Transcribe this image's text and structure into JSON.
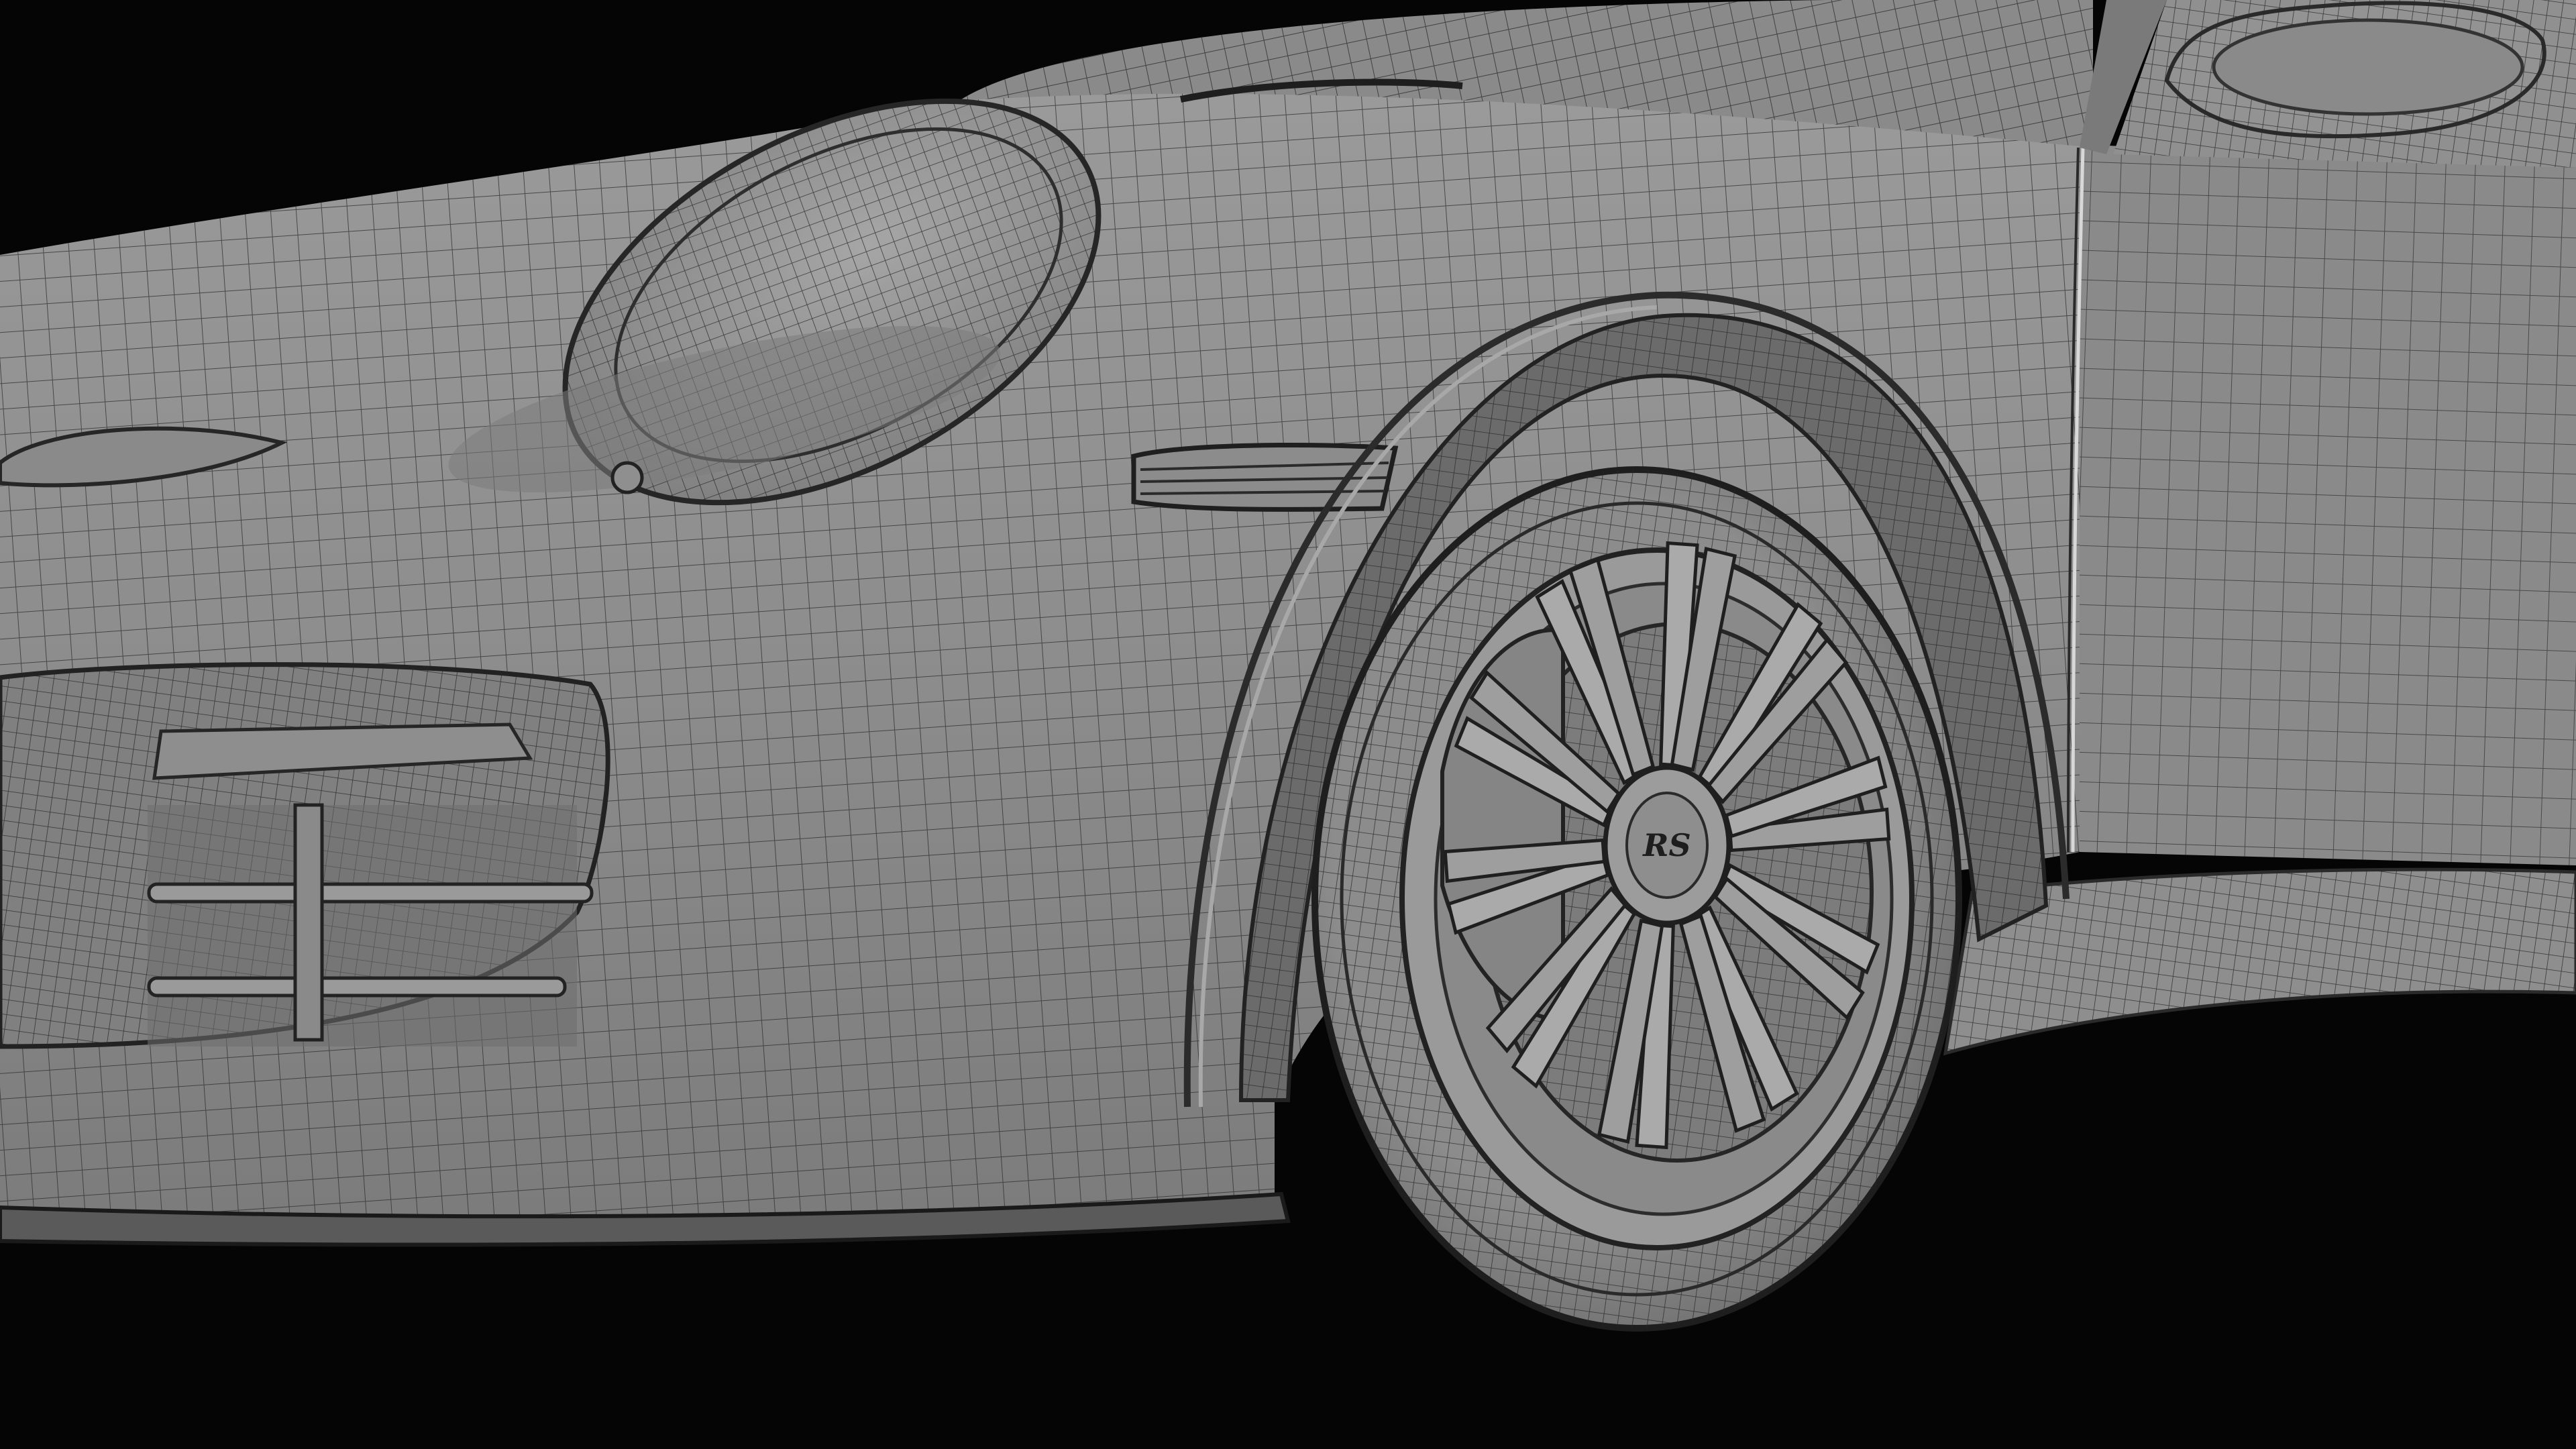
{
  "scene": {
    "background": "#050505",
    "body_color": "#8f8f8f",
    "wire_color": "#303030",
    "tire_color": "#868686",
    "rim_color": "#a4a4a4",
    "indicator_color": "#8c8c8c"
  },
  "wheel": {
    "spoke_count": 20,
    "hub_logo": "RS"
  }
}
